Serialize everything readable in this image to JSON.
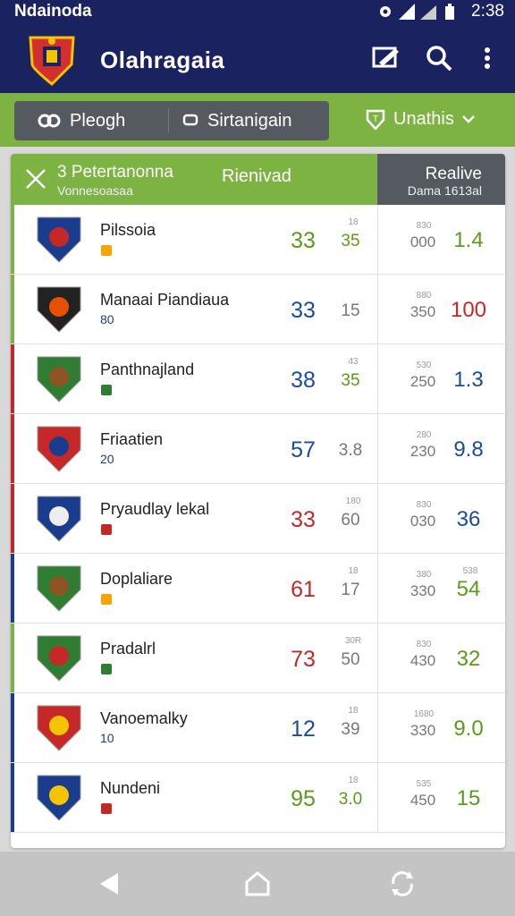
{
  "status": {
    "carrier": "Ndainoda",
    "time": "2:38"
  },
  "app": {
    "title": "Olahragaia"
  },
  "filters": {
    "btn1": "Pleogh",
    "btn2": "Sirtanigain",
    "dropdown": "Unathis"
  },
  "table": {
    "header_title": "3 Petertanonna",
    "header_sub": "Vonnesoasaa",
    "header_mid": "Rienivad",
    "header_right": "Realive",
    "header_right_sub": "Dama 1613al"
  },
  "rows": [
    {
      "name": "Pilssoia",
      "sub": "",
      "score": "33",
      "s2top": "18",
      "s2": "35",
      "s3top": "830",
      "s3": "000",
      "s4top": "",
      "s4": "1.4",
      "bar": "#7cb342",
      "score_color": "green",
      "s2_color": "green",
      "s4_color": "green"
    },
    {
      "name": "Manaai Piandiaua",
      "sub": "80",
      "score": "33",
      "s2top": "",
      "s2": "15",
      "s3top": "880",
      "s3": "350",
      "s4top": "",
      "s4": "100",
      "bar": "#7cb342",
      "score_color": "blue",
      "s2_color": "grey",
      "s4_color": "red"
    },
    {
      "name": "Panthnajland",
      "sub": "",
      "score": "38",
      "s2top": "43",
      "s2": "35",
      "s3top": "530",
      "s3": "250",
      "s4top": "",
      "s4": "1.3",
      "bar": "#c62828",
      "score_color": "blue",
      "s2_color": "green",
      "s4_color": "blue"
    },
    {
      "name": "Friaatien",
      "sub": "20",
      "score": "57",
      "s2top": "",
      "s2": "3.8",
      "s3top": "280",
      "s3": "230",
      "s4top": "",
      "s4": "9.8",
      "bar": "#c62828",
      "score_color": "blue",
      "s2_color": "grey",
      "s4_color": "blue"
    },
    {
      "name": "Pryaudlay lekal",
      "sub": "",
      "score": "33",
      "s2top": "180",
      "s2": "60",
      "s3top": "830",
      "s3": "030",
      "s4top": "",
      "s4": "36",
      "bar": "#c62828",
      "score_color": "red",
      "s2_color": "grey",
      "s4_color": "blue"
    },
    {
      "name": "Doplaliare",
      "sub": "",
      "score": "61",
      "s2top": "18",
      "s2": "17",
      "s3top": "380",
      "s3": "330",
      "s4top": "538",
      "s4": "54",
      "bar": "#1a3c8c",
      "score_color": "red",
      "s2_color": "grey",
      "s4_color": "green"
    },
    {
      "name": "Pradalrl",
      "sub": "",
      "score": "73",
      "s2top": "30R",
      "s2": "50",
      "s3top": "830",
      "s3": "430",
      "s4top": "",
      "s4": "32",
      "bar": "#7cb342",
      "score_color": "red",
      "s2_color": "grey",
      "s4_color": "green"
    },
    {
      "name": "Vanoemalky",
      "sub": "10",
      "score": "12",
      "s2top": "18",
      "s2": "39",
      "s3top": "1680",
      "s3": "330",
      "s4top": "",
      "s4": "9.0",
      "bar": "#1a3c8c",
      "score_color": "blue",
      "s2_color": "grey",
      "s4_color": "green"
    },
    {
      "name": "Nundeni",
      "sub": "",
      "score": "95",
      "s2top": "18",
      "s2": "3.0",
      "s3top": "535",
      "s3": "450",
      "s4top": "",
      "s4": "15",
      "bar": "#1a3c8c",
      "score_color": "green",
      "s2_color": "green",
      "s4_color": "green"
    }
  ]
}
